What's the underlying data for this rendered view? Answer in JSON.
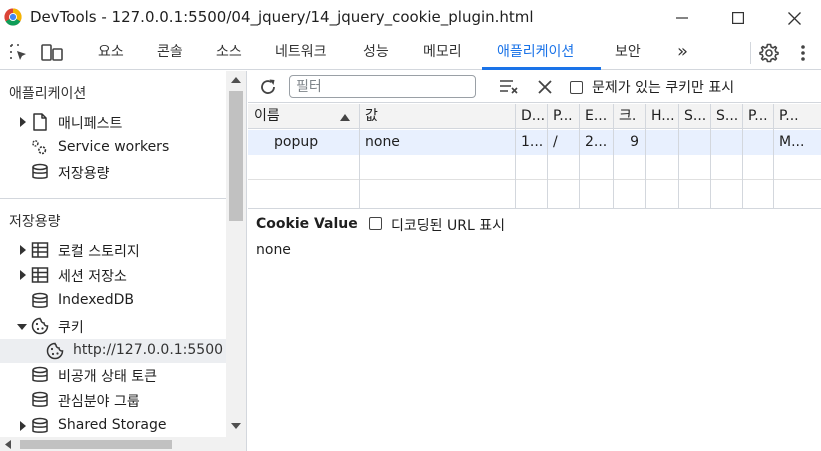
{
  "window": {
    "title": "DevTools - 127.0.0.1:5500/04_jquery/14_jquery_cookie_plugin.html"
  },
  "tabs": [
    "요소",
    "콘솔",
    "소스",
    "네트워크",
    "성능",
    "메모리",
    "애플리케이션",
    "보안"
  ],
  "tabs_more": "»",
  "sidebar": {
    "section1": "애플리케이션",
    "app_items": [
      "매니페스트",
      "Service workers",
      "저장용량"
    ],
    "section2": "저장용량",
    "storage_items": [
      "로컬 스토리지",
      "세션 저장소",
      "IndexedDB",
      "쿠키",
      "http://127.0.0.1:5500",
      "비공개 상태 토큰",
      "관심분야 그룹",
      "Shared Storage"
    ]
  },
  "toolbar": {
    "filter_placeholder": "필터",
    "only_issues_label": "문제가 있는 쿠키만 표시"
  },
  "table": {
    "headers": [
      "이름",
      "값",
      "D...",
      "P...",
      "E...",
      "크.",
      "H...",
      "S...",
      "S...",
      "P...",
      "P..."
    ],
    "rows": [
      [
        "popup",
        "none",
        "1...",
        "/",
        "2...",
        "9",
        "",
        "",
        "",
        "",
        "M..."
      ]
    ]
  },
  "details": {
    "label": "Cookie Value",
    "decode_label": "디코딩된 URL 표시",
    "value": "none"
  },
  "colors": {
    "accent": "#1a73e8",
    "selected_row": "#e8f0fe",
    "header_bg": "#f3f3f3",
    "border": "#d3d7dd"
  }
}
